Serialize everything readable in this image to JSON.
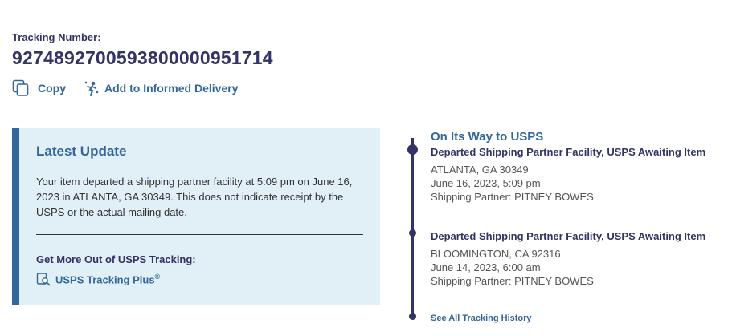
{
  "tracking": {
    "label": "Tracking Number:",
    "number": "9274892700593800000951714",
    "copy_label": "Copy",
    "informed_label": "Add to Informed Delivery"
  },
  "latest": {
    "title": "Latest Update",
    "text": "Your item departed a shipping partner facility at 5:09 pm on June 16, 2023 in ATLANTA, GA 30349. This does not indicate receipt by the USPS or the actual mailing date.",
    "get_more": "Get More Out of USPS Tracking:",
    "plus_label": "USPS Tracking Plus",
    "plus_sup": "®"
  },
  "timeline": {
    "status": "On Its Way to USPS",
    "events": [
      {
        "title": "Departed Shipping Partner Facility, USPS Awaiting Item",
        "location": "ATLANTA, GA 30349",
        "datetime": "June 16, 2023, 5:09 pm",
        "partner": "Shipping Partner: PITNEY BOWES"
      },
      {
        "title": "Departed Shipping Partner Facility, USPS Awaiting Item",
        "location": "BLOOMINGTON, CA 92316",
        "datetime": "June 14, 2023, 6:00 am",
        "partner": "Shipping Partner: PITNEY BOWES"
      }
    ],
    "see_all": "See All Tracking History"
  },
  "icons": {
    "copy": "copy-icon",
    "informed": "informed-delivery-icon",
    "plus": "tracking-plus-icon"
  },
  "colors": {
    "navy": "#333366",
    "link_blue": "#336699",
    "panel_bg": "#e1eff7"
  }
}
